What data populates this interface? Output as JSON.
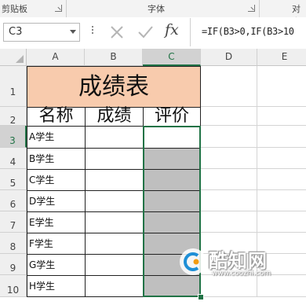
{
  "ribbon": {
    "groups": [
      "剪贴板",
      "字体",
      "对齐"
    ]
  },
  "formula_bar": {
    "name_box": "C3",
    "fx_label": "fx",
    "formula": "=IF(B3>0,IF(B3>10"
  },
  "columns": [
    "A",
    "B",
    "C",
    "D",
    "E"
  ],
  "rows": [
    "1",
    "2",
    "3",
    "4",
    "5",
    "6",
    "7",
    "8",
    "9",
    "10"
  ],
  "sheet": {
    "title": "成绩表",
    "headers": [
      "名称",
      "成绩",
      "评价"
    ],
    "students": [
      "A学生",
      "B学生",
      "C学生",
      "D学生",
      "E学生",
      "F学生",
      "G学生",
      "H学生"
    ],
    "colors": {
      "title_fill": "#f8cbad",
      "selected_fill": "#bfbfbf",
      "selection": "#217346"
    }
  },
  "watermark": {
    "name": "酷知网",
    "url": "www.coozhi.com"
  }
}
